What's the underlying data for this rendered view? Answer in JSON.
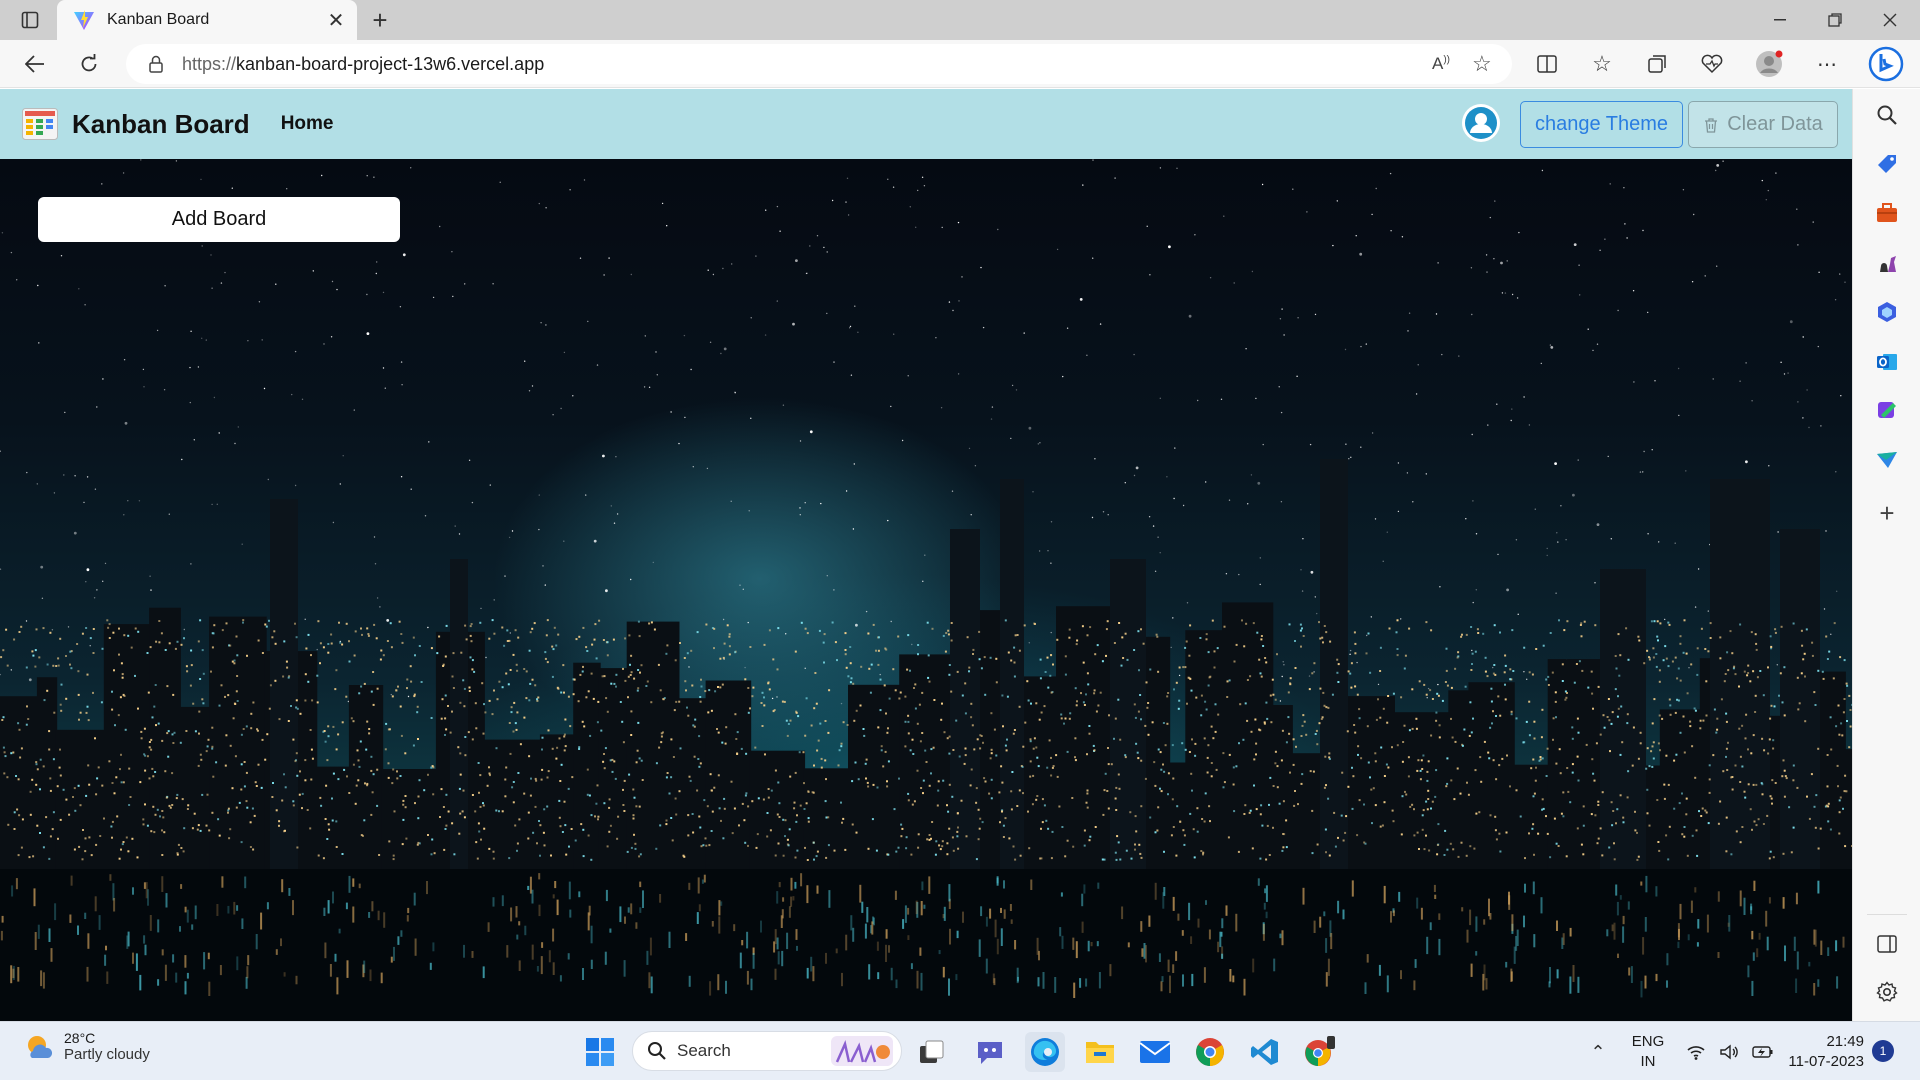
{
  "browser": {
    "tab_title": "Kanban Board",
    "url_scheme": "https://",
    "url_host": "kanban-board-project-13w6.vercel.app"
  },
  "page": {
    "brand": "Kanban Board",
    "nav_home": "Home",
    "change_theme_label": "change Theme",
    "clear_data_label": "Clear Data",
    "add_board_label": "Add Board",
    "navbar_color": "#b2dfe6",
    "accent_color": "#2a7de1"
  },
  "taskbar": {
    "weather_temp": "28°C",
    "weather_condition": "Partly cloudy",
    "search_label": "Search",
    "lang_top": "ENG",
    "lang_bottom": "IN",
    "time": "21:49",
    "date": "11-07-2023",
    "notification_count": "1"
  },
  "icons": {
    "sidebar": [
      "search-icon",
      "tag-icon",
      "briefcase-icon",
      "chess-icon",
      "copilot-icon",
      "outlook-icon",
      "designer-icon",
      "send-icon",
      "add-icon",
      "split-panel-icon",
      "settings-icon"
    ],
    "taskbar": [
      "start-icon",
      "task-view-icon",
      "teams-icon",
      "edge-icon",
      "file-explorer-icon",
      "mail-icon",
      "chrome-icon",
      "vscode-icon",
      "chrome-canary-icon"
    ]
  }
}
